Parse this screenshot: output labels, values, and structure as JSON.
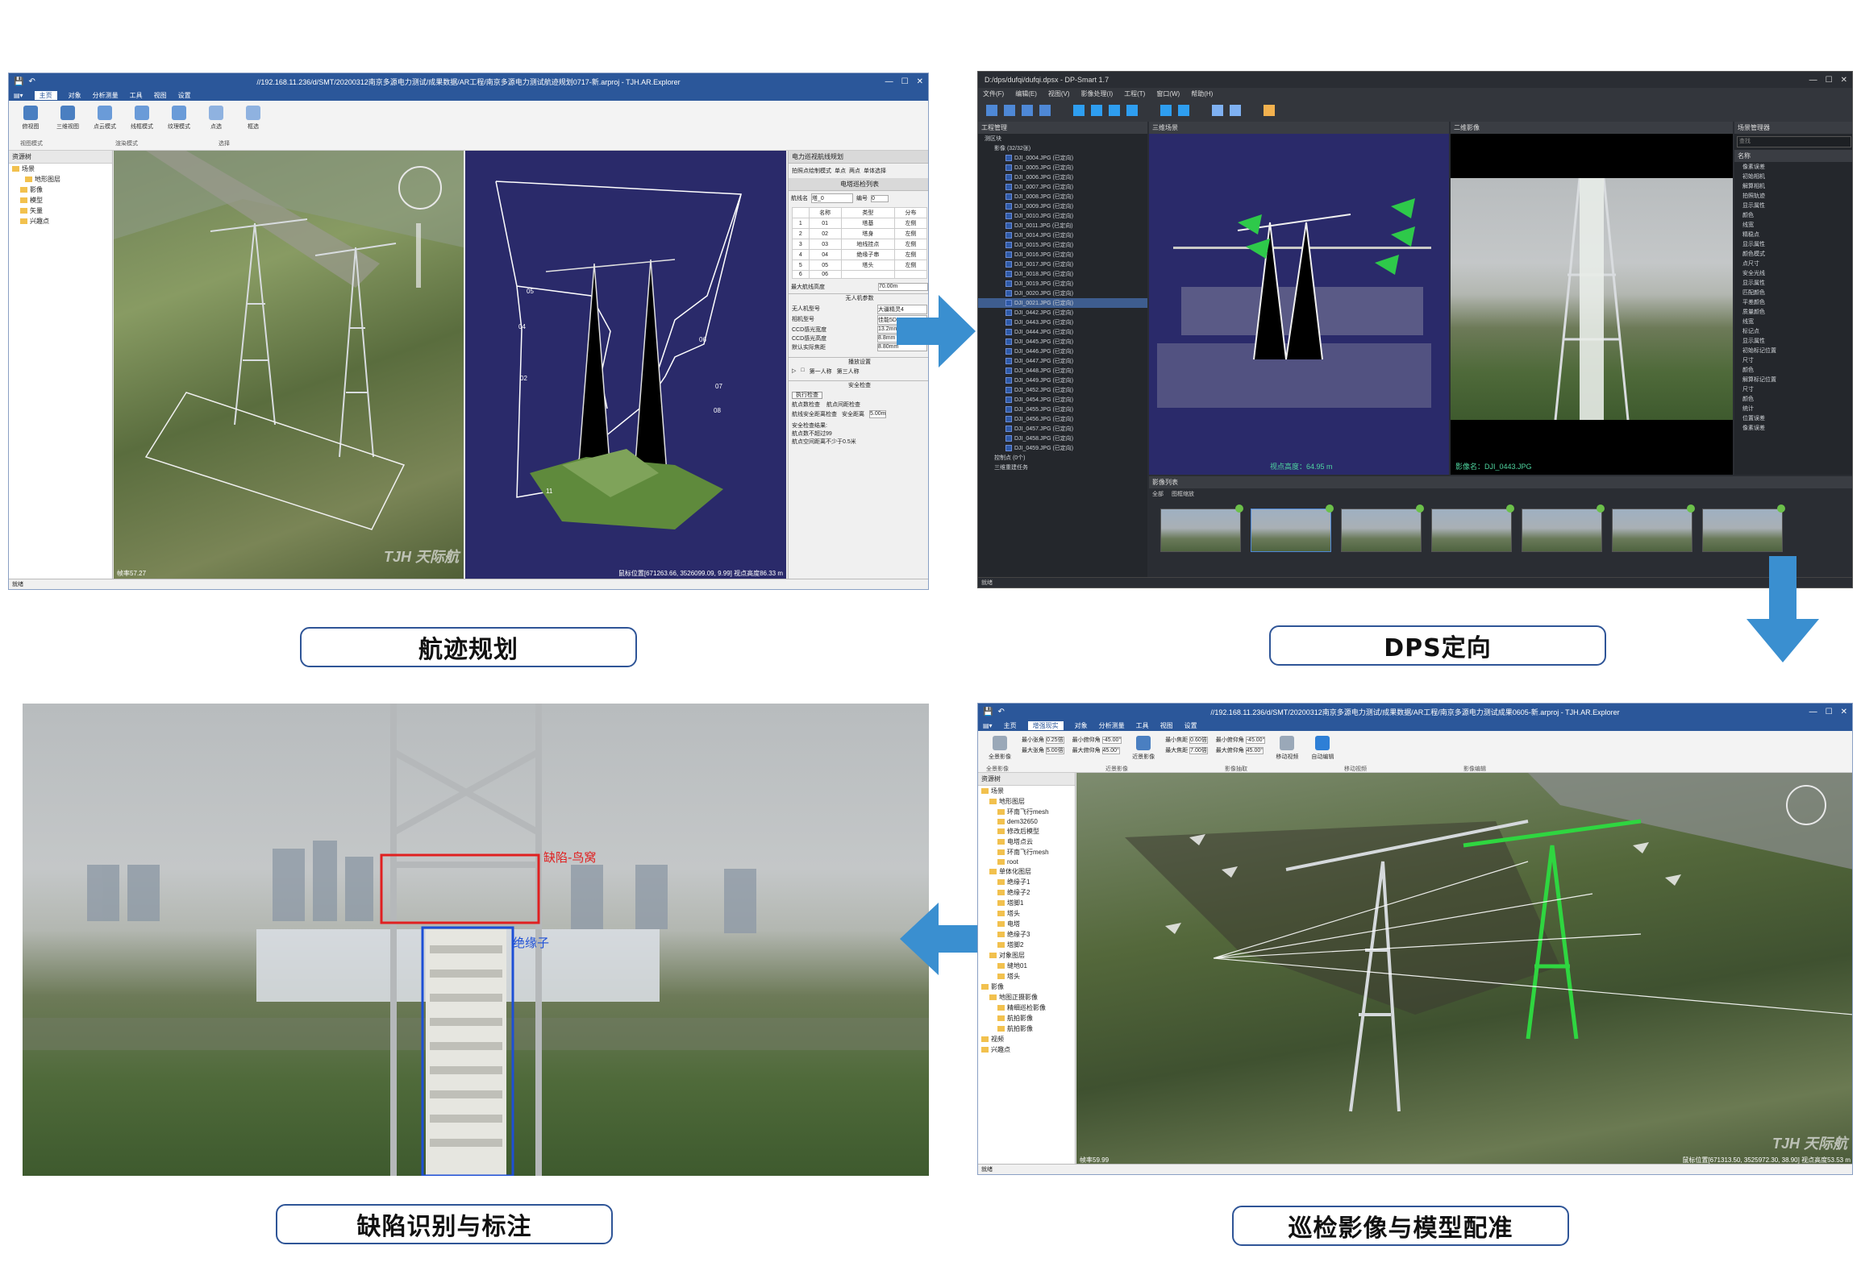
{
  "captions": {
    "trajectory": "航迹规划",
    "dps": "DPS定向",
    "defect": "缺陷识别与标注",
    "registration": "巡检影像与模型配准"
  },
  "colors": {
    "caption_border": "#2f5597",
    "arrow": "#3a8fd0",
    "ribbon_blue": "#2b579a"
  },
  "p1": {
    "window_title": "//192.168.11.236/d/SMT/20200312南京多源电力测试/成果数据/AR工程/南京多源电力测试航迹规划0717-新.arproj - TJH.AR.Explorer",
    "tabs": [
      "主页",
      "对象",
      "分析测量",
      "工具",
      "视图",
      "设置"
    ],
    "active_tab": "主页",
    "ribbon": [
      "俯视图",
      "三维视图",
      "点云模式",
      "线框模式",
      "纹理模式",
      "点选",
      "框选"
    ],
    "ribbon_groups": [
      "视图模式",
      "渲染模式",
      "选择"
    ],
    "tree_header": "资源树",
    "tree": [
      "场景",
      "地形图层",
      "影像",
      "模型",
      "矢量",
      "兴趣点"
    ],
    "right_header": "电力巡视航线规划",
    "right_options": [
      "拍照点绘制模式",
      "单点",
      "两点",
      "单体选择"
    ],
    "list_header": "电塔巡检列表",
    "route_label": "航线名",
    "route_value": "塔_0",
    "index_label": "编号",
    "index_value": "0",
    "table_header": [
      "名称",
      "类型",
      "分布"
    ],
    "table_rows": [
      [
        "1",
        "01",
        "塔基",
        "左侧"
      ],
      [
        "2",
        "02",
        "塔身",
        "左侧"
      ],
      [
        "3",
        "03",
        "地线挂点",
        "左侧"
      ],
      [
        "4",
        "04",
        "绝缘子串",
        "左侧"
      ],
      [
        "5",
        "05",
        "塔头",
        "左侧"
      ],
      [
        "6",
        "06",
        "",
        ""
      ]
    ],
    "max_height_label": "最大航线高度",
    "max_height_value": "70.00m",
    "uav_header": "无人机参数",
    "uav_params": [
      [
        "无人机型号",
        "大疆精灵4"
      ],
      [
        "相机型号",
        "佳能5D"
      ],
      [
        "CCD感光宽度",
        "13.2mm"
      ],
      [
        "CCD感光高度",
        "8.8mm"
      ],
      [
        "默认实际焦距",
        "8.80mm"
      ]
    ],
    "play_header": "播放设置",
    "play_options": [
      "第一人称",
      "第三人称"
    ],
    "safety_header": "安全检查",
    "safety_button": "执行检查",
    "safety_checks": [
      "航点数检查",
      "航点间距检查",
      "航线安全距离检查",
      "安全距离"
    ],
    "safety_distance": "5.00m",
    "result_header": "安全检查结果:",
    "results": [
      "航点数不超过99",
      "航点空间距离不少于0.5米"
    ],
    "waypoints": [
      "01",
      "02",
      "03",
      "04",
      "05",
      "06",
      "07",
      "08",
      "09",
      "10",
      "11"
    ],
    "status_left": "就绪",
    "status_fps": "帧率57.27",
    "status_coords": "鼠标位置[671263.66, 3526099.09, 9.99] 视点高度86.33 m",
    "watermark": "TJH 天际航"
  },
  "p2": {
    "window_title": "D:/dps/dufqi/dufqi.dpsx - DP-Smart 1.7",
    "menus": [
      "文件(F)",
      "编辑(E)",
      "视图(V)",
      "影像处理(I)",
      "工程(T)",
      "窗口(W)",
      "帮助(H)"
    ],
    "project_header": "工程管理",
    "block_label": "测区块",
    "image_group": "影像 (32/32张)",
    "images": [
      "DJI_0004.JPG (已定向)",
      "DJI_0005.JPG (已定向)",
      "DJI_0006.JPG (已定向)",
      "DJI_0007.JPG (已定向)",
      "DJI_0008.JPG (已定向)",
      "DJI_0009.JPG (已定向)",
      "DJI_0010.JPG (已定向)",
      "DJI_0011.JPG (已定向)",
      "DJI_0014.JPG (已定向)",
      "DJI_0015.JPG (已定向)",
      "DJI_0016.JPG (已定向)",
      "DJI_0017.JPG (已定向)",
      "DJI_0018.JPG (已定向)",
      "DJI_0019.JPG (已定向)",
      "DJI_0020.JPG (已定向)",
      "DJI_0021.JPG (已定向)",
      "DJI_0442.JPG (已定向)",
      "DJI_0443.JPG (已定向)",
      "DJI_0444.JPG (已定向)",
      "DJI_0445.JPG (已定向)",
      "DJI_0446.JPG (已定向)",
      "DJI_0447.JPG (已定向)",
      "DJI_0448.JPG (已定向)",
      "DJI_0449.JPG (已定向)",
      "DJI_0452.JPG (已定向)",
      "DJI_0454.JPG (已定向)",
      "DJI_0455.JPG (已定向)",
      "DJI_0456.JPG (已定向)",
      "DJI_0457.JPG (已定向)",
      "DJI_0458.JPG (已定向)",
      "DJI_0459.JPG (已定向)"
    ],
    "selected_image_index": 15,
    "control_points": "控制点 (0个)",
    "task_label": "三维重建任务",
    "scene_header": "三维场景",
    "image_header": "二维影像",
    "view_height": "视点高度：64.95 m",
    "image_name": "影像名：DJI_0443.JPG",
    "film_header": "影像列表",
    "film_options": [
      "全部",
      "图框缩放"
    ],
    "scene_manager": "场景管理器",
    "search_placeholder": "查找",
    "props_header": "名称",
    "props": [
      "像素误差",
      "初始相机",
      "解算相机",
      "拍照轨迹",
      "显示属性",
      "颜色",
      "线宽",
      "精稳点",
      "显示属性",
      "颜色模式",
      "点尺寸",
      "安全光线",
      "显示属性",
      "匹配颜色",
      "平差颜色",
      "质量颜色",
      "线宽",
      "标记点",
      "显示属性",
      "初始标记位置",
      "尺寸",
      "颜色",
      "解算标记位置",
      "尺寸",
      "颜色",
      "统计",
      "位置误差",
      "像素误差"
    ],
    "status": "就绪"
  },
  "p3": {
    "defect_label": "缺陷-鸟窝",
    "insulator_label": "绝缘子"
  },
  "p4": {
    "window_title": "//192.168.11.236/d/SMT/20200312南京多源电力测试/成果数据/AR工程/南京多源电力测试成果0605-新.arproj - TJH.AR.Explorer",
    "tabs": [
      "主页",
      "增强现实",
      "对象",
      "分析测量",
      "工具",
      "视图",
      "设置"
    ],
    "active_tab": "增强现实",
    "ribbon_groups": [
      "全景影像",
      "近景影像",
      "影像抽取",
      "移动视频",
      "影像编辑"
    ],
    "ribbon_fields": [
      [
        "最小张角",
        "0.25倍"
      ],
      [
        "最大张角",
        "5.00倍"
      ],
      [
        "最小俯仰角",
        "-45.00°"
      ],
      [
        "最大俯仰角",
        "45.00°"
      ],
      [
        "最小焦距",
        "0.60倍"
      ],
      [
        "最大焦距",
        "7.00倍"
      ],
      [
        "最小俯仰角",
        "-45.00°"
      ],
      [
        "最大俯仰角",
        "45.00°"
      ]
    ],
    "ribbon_buttons": [
      "全景影像",
      "近景影像",
      "移动视频",
      "自动编辑"
    ],
    "tree_header": "资源树",
    "tree": [
      "场景",
      "地形图层",
      "环南飞行mesh",
      "dem32650",
      "修改后模型",
      "电塔点云",
      "环南飞行mesh",
      "root",
      "单体化图层",
      "绝缘子1",
      "绝缘子2",
      "塔脚1",
      "塔头",
      "电塔",
      "绝缘子3",
      "塔脚2",
      "对象图层",
      "缝地01",
      "塔头",
      "影像",
      "地图正摄影像",
      "精细巡检影像",
      "航拍影像",
      "航拍影像",
      "视频",
      "兴趣点"
    ],
    "status_left": "就绪",
    "status_fps": "帧率59.99",
    "status_coords": "鼠标位置[671313.50, 3525972.30, 38.90] 视点高度53.53 m",
    "watermark": "TJH 天际航"
  }
}
